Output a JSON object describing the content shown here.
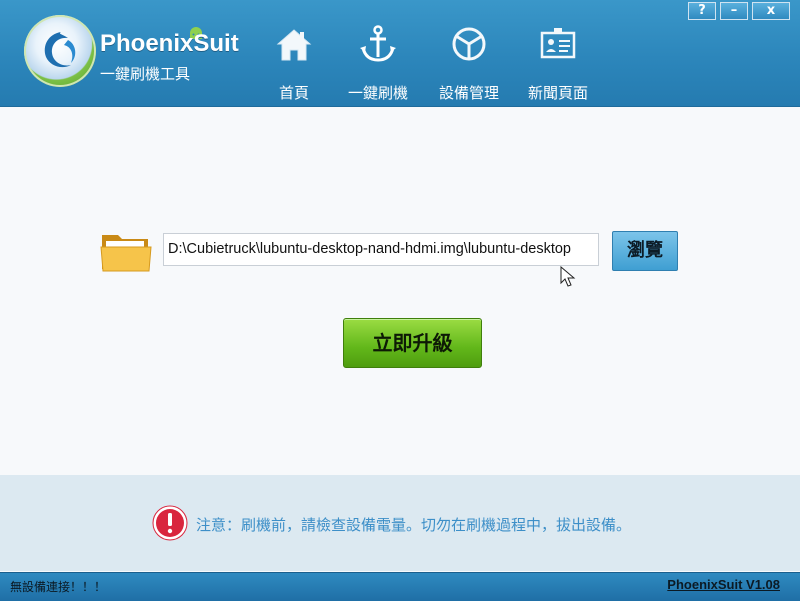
{
  "header": {
    "brand_title": "PhoenixSuit",
    "brand_subtitle": "一鍵刷機工具",
    "nav": [
      {
        "label": "首頁",
        "icon": "home-icon"
      },
      {
        "label": "一鍵刷機",
        "icon": "anchor-icon"
      },
      {
        "label": "設備管理",
        "icon": "device-icon"
      },
      {
        "label": "新聞頁面",
        "icon": "news-icon"
      }
    ],
    "window_buttons": {
      "help": "?",
      "minimize": "–",
      "close": "x"
    }
  },
  "main": {
    "image_path": "D:\\Cubietruck\\lubuntu-desktop-nand-hdmi.img\\lubuntu-desktop",
    "browse_label": "瀏覽",
    "upgrade_label": "立即升級"
  },
  "notice": {
    "text": "注意：刷機前，請檢查設備電量。切勿在刷機過程中，拔出設備。"
  },
  "status": {
    "connection": "無設備連接！！！",
    "version": "PhoenixSuit V1.08"
  },
  "colors": {
    "header_blue": "#2c86bb",
    "upgrade_green": "#62b71a",
    "browse_blue": "#3f9fd2",
    "notice_text": "#3d8fc8",
    "notice_band": "#dce9f1",
    "warning_red": "#d9263e"
  }
}
